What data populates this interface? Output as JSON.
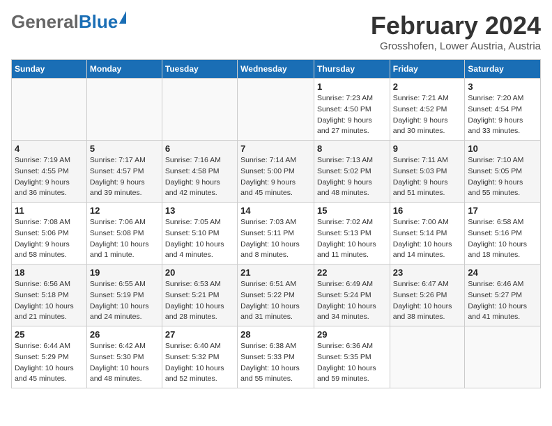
{
  "header": {
    "title": "February 2024",
    "subtitle": "Grosshofen, Lower Austria, Austria",
    "logo_general": "General",
    "logo_blue": "Blue"
  },
  "days_of_week": [
    "Sunday",
    "Monday",
    "Tuesday",
    "Wednesday",
    "Thursday",
    "Friday",
    "Saturday"
  ],
  "weeks": [
    [
      {
        "day": "",
        "details": []
      },
      {
        "day": "",
        "details": []
      },
      {
        "day": "",
        "details": []
      },
      {
        "day": "",
        "details": []
      },
      {
        "day": "1",
        "details": [
          "Sunrise: 7:23 AM",
          "Sunset: 4:50 PM",
          "Daylight: 9 hours",
          "and 27 minutes."
        ]
      },
      {
        "day": "2",
        "details": [
          "Sunrise: 7:21 AM",
          "Sunset: 4:52 PM",
          "Daylight: 9 hours",
          "and 30 minutes."
        ]
      },
      {
        "day": "3",
        "details": [
          "Sunrise: 7:20 AM",
          "Sunset: 4:54 PM",
          "Daylight: 9 hours",
          "and 33 minutes."
        ]
      }
    ],
    [
      {
        "day": "4",
        "details": [
          "Sunrise: 7:19 AM",
          "Sunset: 4:55 PM",
          "Daylight: 9 hours",
          "and 36 minutes."
        ]
      },
      {
        "day": "5",
        "details": [
          "Sunrise: 7:17 AM",
          "Sunset: 4:57 PM",
          "Daylight: 9 hours",
          "and 39 minutes."
        ]
      },
      {
        "day": "6",
        "details": [
          "Sunrise: 7:16 AM",
          "Sunset: 4:58 PM",
          "Daylight: 9 hours",
          "and 42 minutes."
        ]
      },
      {
        "day": "7",
        "details": [
          "Sunrise: 7:14 AM",
          "Sunset: 5:00 PM",
          "Daylight: 9 hours",
          "and 45 minutes."
        ]
      },
      {
        "day": "8",
        "details": [
          "Sunrise: 7:13 AM",
          "Sunset: 5:02 PM",
          "Daylight: 9 hours",
          "and 48 minutes."
        ]
      },
      {
        "day": "9",
        "details": [
          "Sunrise: 7:11 AM",
          "Sunset: 5:03 PM",
          "Daylight: 9 hours",
          "and 51 minutes."
        ]
      },
      {
        "day": "10",
        "details": [
          "Sunrise: 7:10 AM",
          "Sunset: 5:05 PM",
          "Daylight: 9 hours",
          "and 55 minutes."
        ]
      }
    ],
    [
      {
        "day": "11",
        "details": [
          "Sunrise: 7:08 AM",
          "Sunset: 5:06 PM",
          "Daylight: 9 hours",
          "and 58 minutes."
        ]
      },
      {
        "day": "12",
        "details": [
          "Sunrise: 7:06 AM",
          "Sunset: 5:08 PM",
          "Daylight: 10 hours",
          "and 1 minute."
        ]
      },
      {
        "day": "13",
        "details": [
          "Sunrise: 7:05 AM",
          "Sunset: 5:10 PM",
          "Daylight: 10 hours",
          "and 4 minutes."
        ]
      },
      {
        "day": "14",
        "details": [
          "Sunrise: 7:03 AM",
          "Sunset: 5:11 PM",
          "Daylight: 10 hours",
          "and 8 minutes."
        ]
      },
      {
        "day": "15",
        "details": [
          "Sunrise: 7:02 AM",
          "Sunset: 5:13 PM",
          "Daylight: 10 hours",
          "and 11 minutes."
        ]
      },
      {
        "day": "16",
        "details": [
          "Sunrise: 7:00 AM",
          "Sunset: 5:14 PM",
          "Daylight: 10 hours",
          "and 14 minutes."
        ]
      },
      {
        "day": "17",
        "details": [
          "Sunrise: 6:58 AM",
          "Sunset: 5:16 PM",
          "Daylight: 10 hours",
          "and 18 minutes."
        ]
      }
    ],
    [
      {
        "day": "18",
        "details": [
          "Sunrise: 6:56 AM",
          "Sunset: 5:18 PM",
          "Daylight: 10 hours",
          "and 21 minutes."
        ]
      },
      {
        "day": "19",
        "details": [
          "Sunrise: 6:55 AM",
          "Sunset: 5:19 PM",
          "Daylight: 10 hours",
          "and 24 minutes."
        ]
      },
      {
        "day": "20",
        "details": [
          "Sunrise: 6:53 AM",
          "Sunset: 5:21 PM",
          "Daylight: 10 hours",
          "and 28 minutes."
        ]
      },
      {
        "day": "21",
        "details": [
          "Sunrise: 6:51 AM",
          "Sunset: 5:22 PM",
          "Daylight: 10 hours",
          "and 31 minutes."
        ]
      },
      {
        "day": "22",
        "details": [
          "Sunrise: 6:49 AM",
          "Sunset: 5:24 PM",
          "Daylight: 10 hours",
          "and 34 minutes."
        ]
      },
      {
        "day": "23",
        "details": [
          "Sunrise: 6:47 AM",
          "Sunset: 5:26 PM",
          "Daylight: 10 hours",
          "and 38 minutes."
        ]
      },
      {
        "day": "24",
        "details": [
          "Sunrise: 6:46 AM",
          "Sunset: 5:27 PM",
          "Daylight: 10 hours",
          "and 41 minutes."
        ]
      }
    ],
    [
      {
        "day": "25",
        "details": [
          "Sunrise: 6:44 AM",
          "Sunset: 5:29 PM",
          "Daylight: 10 hours",
          "and 45 minutes."
        ]
      },
      {
        "day": "26",
        "details": [
          "Sunrise: 6:42 AM",
          "Sunset: 5:30 PM",
          "Daylight: 10 hours",
          "and 48 minutes."
        ]
      },
      {
        "day": "27",
        "details": [
          "Sunrise: 6:40 AM",
          "Sunset: 5:32 PM",
          "Daylight: 10 hours",
          "and 52 minutes."
        ]
      },
      {
        "day": "28",
        "details": [
          "Sunrise: 6:38 AM",
          "Sunset: 5:33 PM",
          "Daylight: 10 hours",
          "and 55 minutes."
        ]
      },
      {
        "day": "29",
        "details": [
          "Sunrise: 6:36 AM",
          "Sunset: 5:35 PM",
          "Daylight: 10 hours",
          "and 59 minutes."
        ]
      },
      {
        "day": "",
        "details": []
      },
      {
        "day": "",
        "details": []
      }
    ]
  ]
}
